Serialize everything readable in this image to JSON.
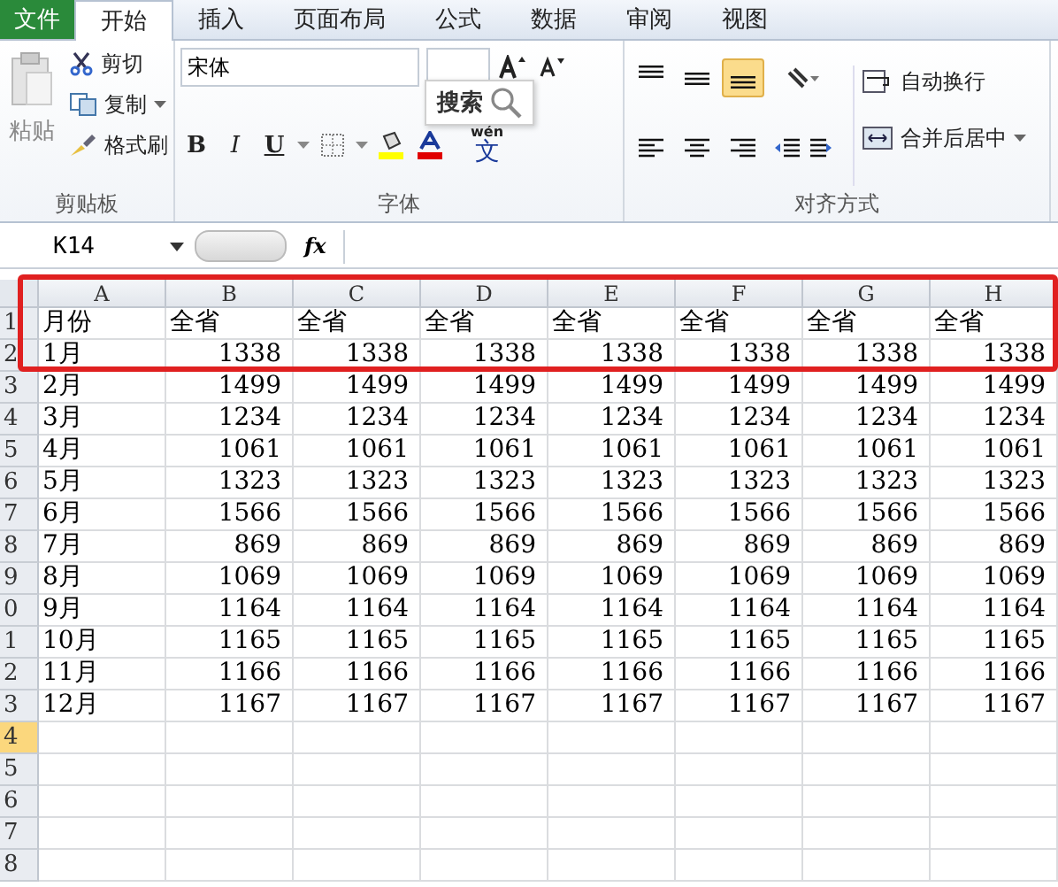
{
  "tabs": [
    {
      "label": "文件",
      "kind": "file",
      "selected": false
    },
    {
      "label": "开始",
      "kind": "tab",
      "selected": true
    },
    {
      "label": "插入",
      "kind": "tab",
      "selected": false
    },
    {
      "label": "页面布局",
      "kind": "tab",
      "selected": false
    },
    {
      "label": "公式",
      "kind": "tab",
      "selected": false
    },
    {
      "label": "数据",
      "kind": "tab",
      "selected": false
    },
    {
      "label": "审阅",
      "kind": "tab",
      "selected": false
    },
    {
      "label": "视图",
      "kind": "tab",
      "selected": false
    }
  ],
  "clipboard": {
    "paste": "粘贴",
    "cut": "剪切",
    "copy": "复制",
    "format_painter": "格式刷",
    "label": "剪贴板"
  },
  "font": {
    "name": "宋体",
    "bold": "B",
    "italic": "I",
    "underline": "U",
    "phonetic_top": "wén",
    "phonetic": "文",
    "label": "字体"
  },
  "search_popup": {
    "label": "搜索"
  },
  "alignment": {
    "wrap": "自动换行",
    "merge": "合并后居中",
    "label": "对齐方式"
  },
  "formula_bar": {
    "name_box": "K14",
    "fx": "fx"
  },
  "sheet": {
    "columns": [
      {
        "label": "A",
        "selected": false
      },
      {
        "label": "B",
        "selected": false
      },
      {
        "label": "C",
        "selected": false
      },
      {
        "label": "D",
        "selected": false
      },
      {
        "label": "E",
        "selected": false
      },
      {
        "label": "F",
        "selected": false
      },
      {
        "label": "G",
        "selected": false
      },
      {
        "label": "H",
        "selected": false
      }
    ],
    "rows": [
      {
        "label": "1",
        "selected": false,
        "kind": "header",
        "cells": [
          "月份",
          "全省",
          "全省",
          "全省",
          "全省",
          "全省",
          "全省",
          "全省"
        ]
      },
      {
        "label": "2",
        "selected": false,
        "kind": "data",
        "cells": [
          "1月",
          "1338",
          "1338",
          "1338",
          "1338",
          "1338",
          "1338",
          "1338"
        ]
      },
      {
        "label": "3",
        "selected": false,
        "kind": "data",
        "cells": [
          "2月",
          "1499",
          "1499",
          "1499",
          "1499",
          "1499",
          "1499",
          "1499"
        ]
      },
      {
        "label": "4",
        "selected": false,
        "kind": "data",
        "cells": [
          "3月",
          "1234",
          "1234",
          "1234",
          "1234",
          "1234",
          "1234",
          "1234"
        ]
      },
      {
        "label": "5",
        "selected": false,
        "kind": "data",
        "cells": [
          "4月",
          "1061",
          "1061",
          "1061",
          "1061",
          "1061",
          "1061",
          "1061"
        ]
      },
      {
        "label": "6",
        "selected": false,
        "kind": "data",
        "cells": [
          "5月",
          "1323",
          "1323",
          "1323",
          "1323",
          "1323",
          "1323",
          "1323"
        ]
      },
      {
        "label": "7",
        "selected": false,
        "kind": "data",
        "cells": [
          "6月",
          "1566",
          "1566",
          "1566",
          "1566",
          "1566",
          "1566",
          "1566"
        ]
      },
      {
        "label": "8",
        "selected": false,
        "kind": "data",
        "cells": [
          "7月",
          "869",
          "869",
          "869",
          "869",
          "869",
          "869",
          "869"
        ]
      },
      {
        "label": "9",
        "selected": false,
        "kind": "data",
        "cells": [
          "8月",
          "1069",
          "1069",
          "1069",
          "1069",
          "1069",
          "1069",
          "1069"
        ]
      },
      {
        "label": "0",
        "selected": false,
        "kind": "data",
        "cells": [
          "9月",
          "1164",
          "1164",
          "1164",
          "1164",
          "1164",
          "1164",
          "1164"
        ]
      },
      {
        "label": "1",
        "selected": false,
        "kind": "data",
        "cells": [
          "10月",
          "1165",
          "1165",
          "1165",
          "1165",
          "1165",
          "1165",
          "1165"
        ]
      },
      {
        "label": "2",
        "selected": false,
        "kind": "data",
        "cells": [
          "11月",
          "1166",
          "1166",
          "1166",
          "1166",
          "1166",
          "1166",
          "1166"
        ]
      },
      {
        "label": "3",
        "selected": false,
        "kind": "data",
        "cells": [
          "12月",
          "1167",
          "1167",
          "1167",
          "1167",
          "1167",
          "1167",
          "1167"
        ]
      },
      {
        "label": "4",
        "selected": true,
        "kind": "empty",
        "cells": []
      },
      {
        "label": "5",
        "selected": false,
        "kind": "empty",
        "cells": []
      },
      {
        "label": "6",
        "selected": false,
        "kind": "empty",
        "cells": []
      },
      {
        "label": "7",
        "selected": false,
        "kind": "empty",
        "cells": []
      },
      {
        "label": "8",
        "selected": false,
        "kind": "empty",
        "cells": []
      }
    ]
  }
}
